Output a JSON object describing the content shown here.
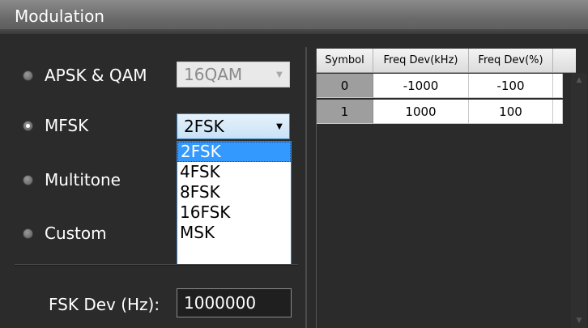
{
  "title": "Modulation",
  "modes": [
    {
      "label": "APSK & QAM",
      "checked": false
    },
    {
      "label": "MFSK",
      "checked": true
    },
    {
      "label": "Multitone",
      "checked": false
    },
    {
      "label": "Custom",
      "checked": false
    }
  ],
  "apsk_combo": {
    "value": "16QAM",
    "disabled": true
  },
  "mfsk_combo": {
    "value": "2FSK",
    "open": true
  },
  "mfsk_options": [
    "2FSK",
    "4FSK",
    "8FSK",
    "16FSK",
    "MSK"
  ],
  "mfsk_selected_option": "2FSK",
  "fsk_dev": {
    "label": "FSK Dev (Hz):",
    "value": "1000000"
  },
  "table": {
    "headers": [
      "Symbol",
      "Freq Dev(kHz)",
      "Freq Dev(%)"
    ],
    "rows": [
      [
        "0",
        "-1000",
        "-100"
      ],
      [
        "1",
        "1000",
        "100"
      ]
    ]
  },
  "icons": {
    "combo_arrow": "chevron-down-icon",
    "scroll_up": "arrow-up-icon",
    "scroll_down": "arrow-down-icon"
  },
  "colors": {
    "background": "#2b2b2b",
    "selection": "#3399ff",
    "combo_active_border": "#3d7fc0"
  }
}
